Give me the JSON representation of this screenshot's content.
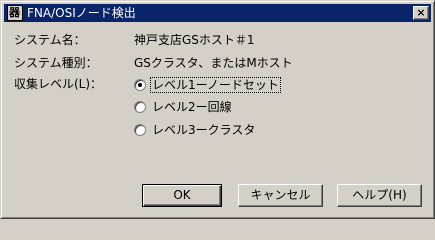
{
  "window": {
    "title": "FNA/OSIノード検出",
    "icon_glyph": "器",
    "close_glyph": "×"
  },
  "fields": {
    "system_name_label": "システム名：",
    "system_name_value": "神戸支店GSホスト＃1",
    "system_type_label": "システム種別：",
    "system_type_value": "GSクラスタ、またはMホスト",
    "collect_level_label": "収集レベル(L)："
  },
  "radios": [
    {
      "label": "レベル1ーノードセット",
      "checked": true
    },
    {
      "label": "レベル2ー回線",
      "checked": false
    },
    {
      "label": "レベル3ークラスタ",
      "checked": false
    }
  ],
  "buttons": {
    "ok": "OK",
    "cancel": "キャンセル",
    "help": "ヘルプ(H)"
  }
}
